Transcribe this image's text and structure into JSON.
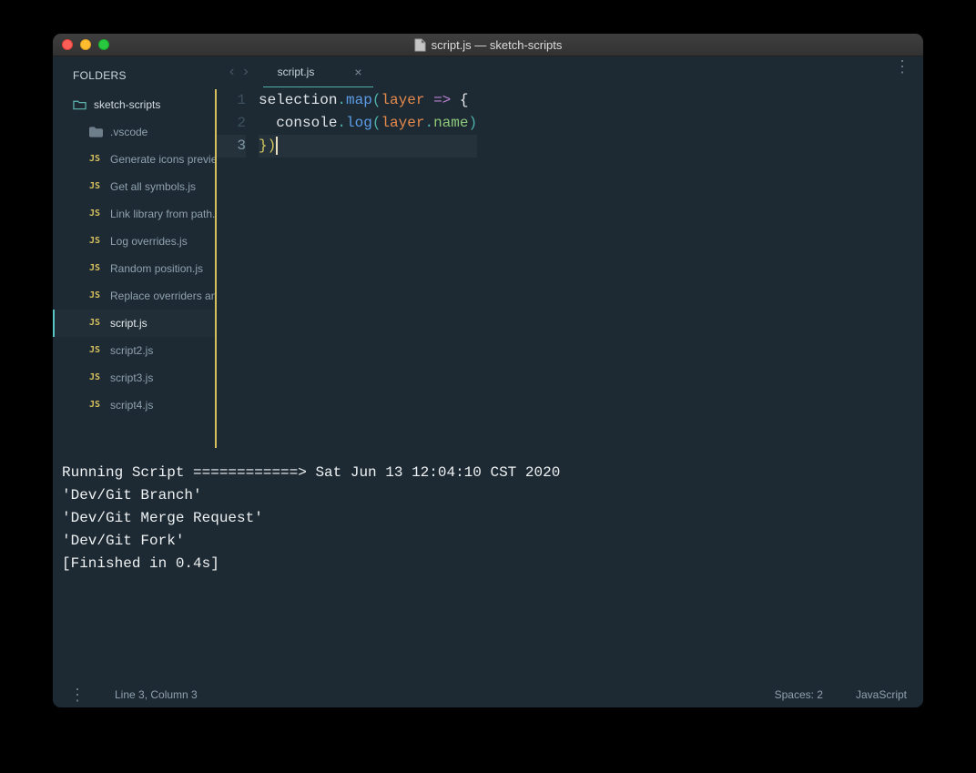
{
  "window": {
    "title": "script.js — sketch-scripts"
  },
  "sidebar": {
    "header": "FOLDERS",
    "root": "sketch-scripts",
    "folder": ".vscode",
    "items": [
      {
        "label": "Generate icons preview.js"
      },
      {
        "label": "Get all symbols.js"
      },
      {
        "label": "Link library from path.js"
      },
      {
        "label": "Log overrides.js"
      },
      {
        "label": "Random position.js"
      },
      {
        "label": "Replace overriders and"
      },
      {
        "label": "script.js",
        "active": true
      },
      {
        "label": "script2.js"
      },
      {
        "label": "script3.js"
      },
      {
        "label": "script4.js"
      }
    ]
  },
  "tabs": {
    "active": "script.js"
  },
  "code": {
    "line_numbers": [
      "1",
      "2",
      "3"
    ],
    "l1": {
      "a": "selection",
      "b": ".",
      "c": "map",
      "d": "(",
      "e": "layer",
      "f": " => ",
      "g": "{"
    },
    "l2": {
      "indent": "  ",
      "a": "console",
      "b": ".",
      "c": "log",
      "d": "(",
      "e": "layer",
      "f": ".",
      "g": "name",
      "h": ")"
    },
    "l3": {
      "a": "}",
      "b": ")"
    }
  },
  "console_lines": [
    "Running Script ============> Sat Jun 13 12:04:10 CST 2020",
    "'Dev/Git Branch'",
    "'Dev/Git Merge Request'",
    "'Dev/Git Fork'",
    "[Finished in 0.4s]"
  ],
  "status": {
    "position": "Line 3, Column 3",
    "indent": "Spaces: 2",
    "language": "JavaScript"
  }
}
